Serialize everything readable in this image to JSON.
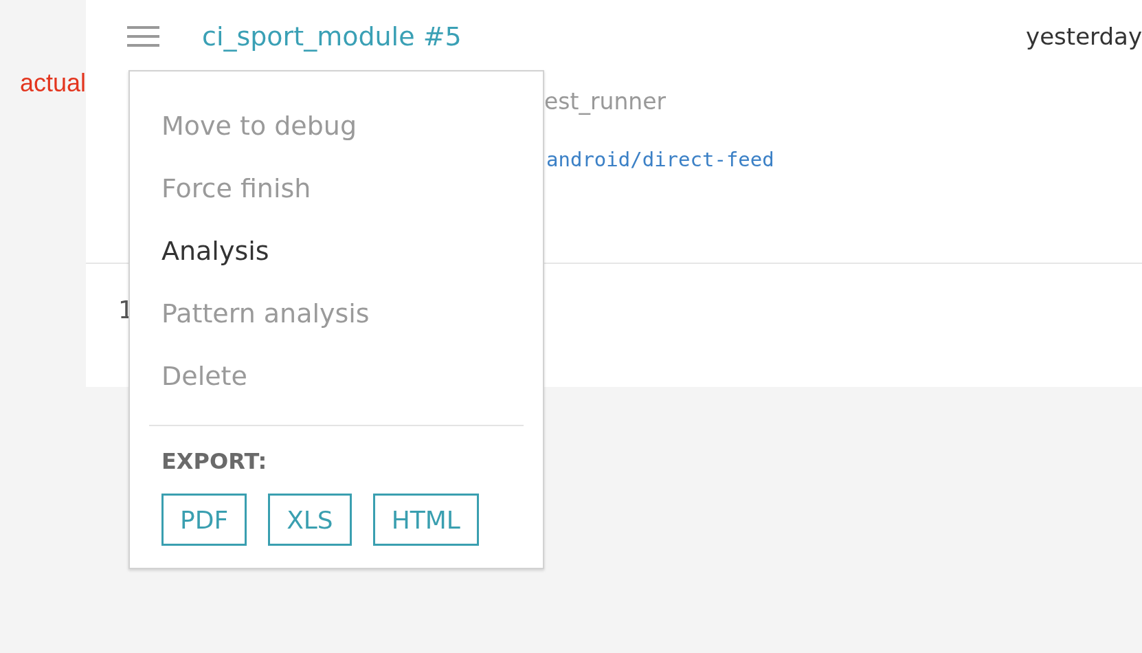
{
  "annotation": "actual",
  "run": {
    "title": "ci_sport_module #5",
    "time": "yesterday",
    "runner": "est_runner",
    "link": "android/direct-feed",
    "count": "1"
  },
  "menu": {
    "items": [
      {
        "label": "Move to debug",
        "disabled": true
      },
      {
        "label": "Force finish",
        "disabled": true
      },
      {
        "label": "Analysis",
        "disabled": false
      },
      {
        "label": "Pattern analysis",
        "disabled": true
      },
      {
        "label": "Delete",
        "disabled": true
      }
    ],
    "export_label": "EXPORT:",
    "export_buttons": [
      "PDF",
      "XLS",
      "HTML"
    ]
  }
}
